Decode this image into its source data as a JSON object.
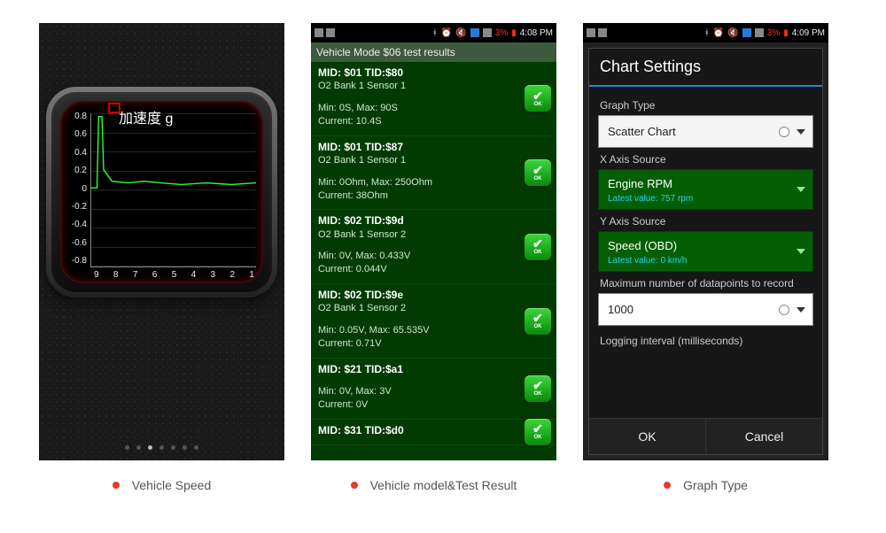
{
  "captions": {
    "s1": "Vehicle Speed",
    "s2": "Vehicle model&Test Result",
    "s3": "Graph Type"
  },
  "statusbar": {
    "battery": "3%",
    "time": "4:08 PM",
    "time3": "4:09 PM"
  },
  "screen1": {
    "title": "加速度 g",
    "y_ticks": [
      "0.8",
      "0.6",
      "0.4",
      "0.2",
      "0",
      "-0.2",
      "-0.4",
      "-0.6",
      "-0.8"
    ],
    "x_ticks": [
      "9",
      "8",
      "7",
      "6",
      "5",
      "4",
      "3",
      "2",
      "1"
    ]
  },
  "chart_data": {
    "type": "line",
    "title": "加速度 g",
    "xlabel": "",
    "ylabel": "",
    "ylim": [
      -0.8,
      0.8
    ],
    "xlim": [
      1,
      9
    ],
    "x": [
      9,
      8.6,
      8.4,
      8.3,
      8,
      7,
      6,
      5,
      4,
      3,
      2,
      1
    ],
    "values": [
      0.0,
      0.9,
      0.9,
      0.2,
      0.08,
      0.06,
      0.08,
      0.05,
      0.07,
      0.06,
      0.05,
      0.06
    ]
  },
  "screen2": {
    "title": "Vehicle Mode $06 test results",
    "ok_label": "OK",
    "items": [
      {
        "hdr": "MID: $01 TID:$80",
        "sub": "O2 Bank 1 Sensor 1",
        "stats1": "Min: 0S, Max: 90S",
        "stats2": "Current: 10.4S"
      },
      {
        "hdr": "MID: $01 TID:$87",
        "sub": "O2 Bank 1 Sensor 1",
        "stats1": "Min: 0Ohm, Max: 250Ohm",
        "stats2": "Current: 38Ohm"
      },
      {
        "hdr": "MID: $02 TID:$9d",
        "sub": "O2 Bank 1 Sensor 2",
        "stats1": "Min: 0V, Max: 0.433V",
        "stats2": "Current: 0.044V"
      },
      {
        "hdr": "MID: $02 TID:$9e",
        "sub": "O2 Bank 1 Sensor 2",
        "stats1": "Min: 0.05V, Max: 65.535V",
        "stats2": "Current: 0.71V"
      },
      {
        "hdr": "MID: $21 TID:$a1",
        "sub": "",
        "stats1": "Min: 0V, Max: 3V",
        "stats2": "Current: 0V"
      },
      {
        "hdr": "MID: $31 TID:$d0",
        "sub": "",
        "stats1": "",
        "stats2": ""
      }
    ]
  },
  "screen3": {
    "dialog_title": "Chart Settings",
    "graph_type_label": "Graph Type",
    "graph_type_value": "Scatter Chart",
    "x_label": "X Axis Source",
    "x_value": "Engine RPM",
    "x_latest": "Latest value: 757 rpm",
    "y_label": "Y Axis Source",
    "y_value": "Speed (OBD)",
    "y_latest": "Latest value: 0 km/h",
    "max_label": "Maximum number of datapoints to record",
    "max_value": "1000",
    "log_label": "Logging interval (milliseconds)",
    "ok": "OK",
    "cancel": "Cancel"
  }
}
